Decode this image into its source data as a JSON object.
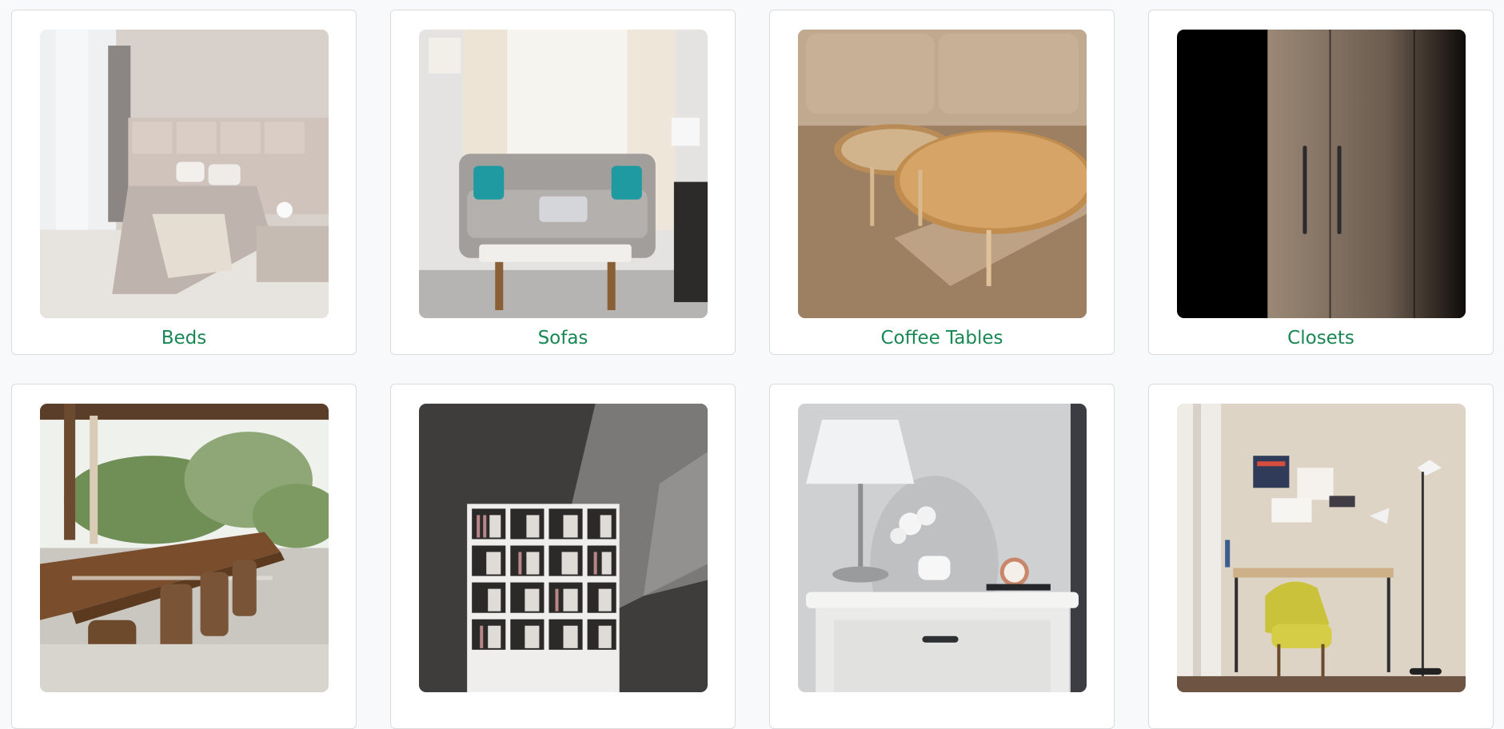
{
  "categories": [
    {
      "label": "Beds",
      "image": "bedroom-photo"
    },
    {
      "label": "Sofas",
      "image": "living-room-sofa-photo"
    },
    {
      "label": "Coffee Tables",
      "image": "round-coffee-tables-photo"
    },
    {
      "label": "Closets",
      "image": "dark-wardrobe-photo"
    },
    {
      "label": "",
      "image": "outdoor-dining-table-photo"
    },
    {
      "label": "",
      "image": "bookshelf-photo"
    },
    {
      "label": "",
      "image": "nightstand-lamp-photo"
    },
    {
      "label": "",
      "image": "home-office-desk-photo"
    }
  ],
  "colors": {
    "page_background": "#f8f9fa",
    "card_background": "#ffffff",
    "card_border": "#d9dbde",
    "label_green": "#198754"
  }
}
